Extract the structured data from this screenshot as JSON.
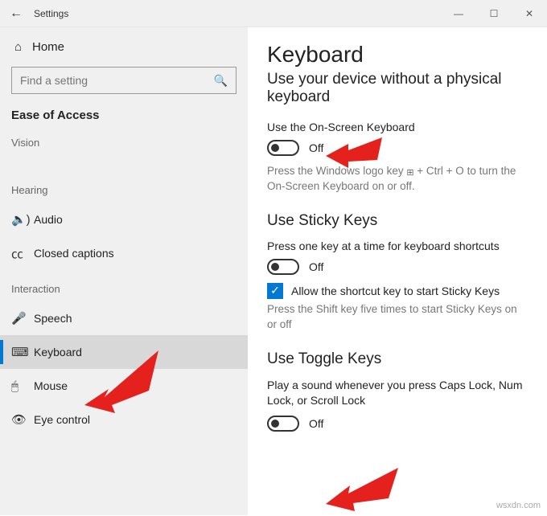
{
  "titlebar": {
    "title": "Settings",
    "minimize": "—",
    "maximize": "☐",
    "close": "✕"
  },
  "sidebar": {
    "home_label": "Home",
    "search_placeholder": "Find a setting",
    "heading": "Ease of Access",
    "cat_vision": "Vision",
    "cat_hearing": "Hearing",
    "item_audio": "Audio",
    "item_cc": "Closed captions",
    "cat_interaction": "Interaction",
    "item_speech": "Speech",
    "item_keyboard": "Keyboard",
    "item_mouse": "Mouse",
    "item_eye": "Eye control"
  },
  "content": {
    "title": "Keyboard",
    "subtitle": "Use your device without a physical keyboard",
    "osk_label": "Use the On-Screen Keyboard",
    "osk_hint_a": "Press the Windows logo key ",
    "osk_hint_b": " + Ctrl + O to turn the On-Screen Keyboard on or off.",
    "sticky_heading": "Use Sticky Keys",
    "sticky_desc": "Press one key at a time for keyboard shortcuts",
    "sticky_chk": "Allow the shortcut key to start Sticky Keys",
    "sticky_hint": "Press the Shift key five times to start Sticky Keys on or off",
    "toggle_heading": "Use Toggle Keys",
    "toggle_desc": "Play a sound whenever you press Caps Lock, Num Lock, or Scroll Lock",
    "state_off": "Off"
  },
  "watermark": "wsxdn.com"
}
